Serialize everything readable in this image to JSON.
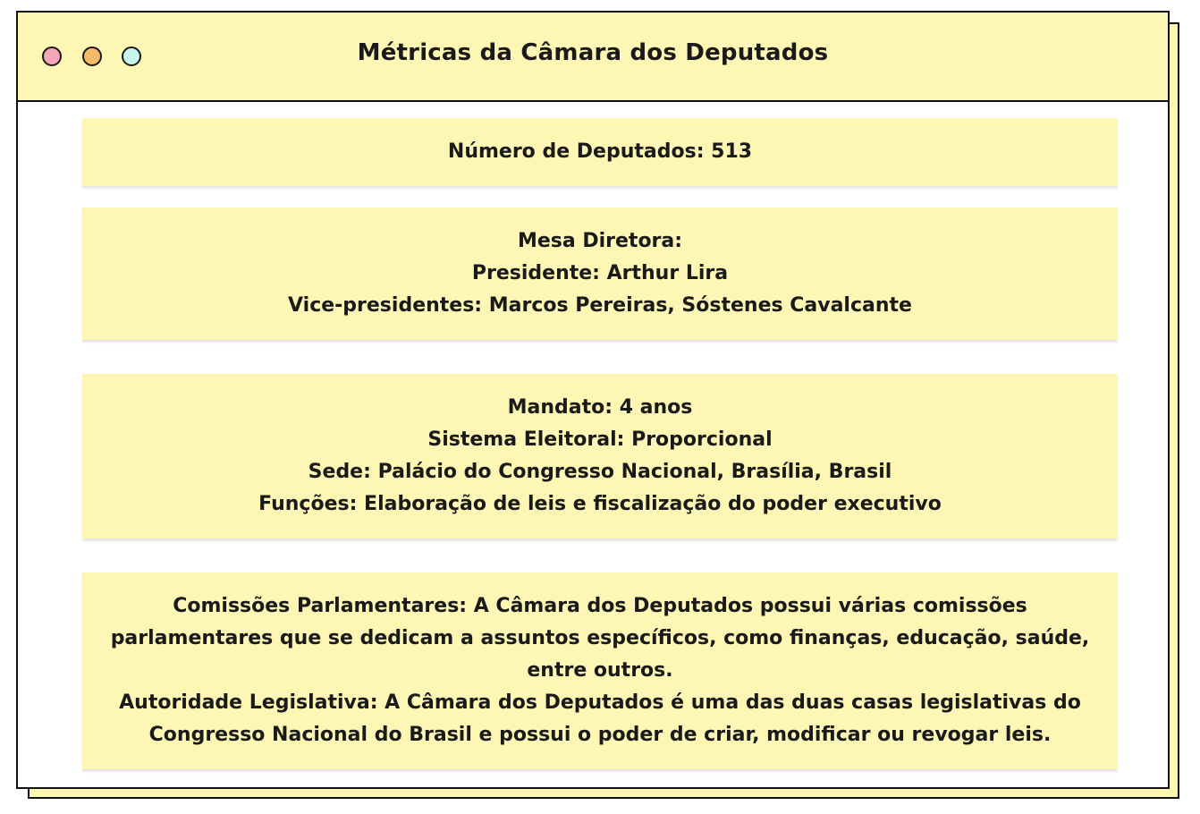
{
  "window": {
    "title": "Métricas da Câmara dos Deputados",
    "controls": {
      "close_color": "#f4a7b9",
      "minimize_color": "#f5b96b",
      "zoom_color": "#c6f4ea"
    }
  },
  "cards": {
    "deputies": {
      "text": "Número de Deputados: 513"
    },
    "board": {
      "heading": "Mesa Diretora:",
      "president": "Presidente: Arthur Lira",
      "vice_presidents": "Vice-presidentes: Marcos Pereiras, Sóstenes Cavalcante"
    },
    "info": {
      "term": "Mandato: 4 anos",
      "electoral_system": "Sistema Eleitoral: Proporcional",
      "seat": "Sede: Palácio do Congresso Nacional, Brasília, Brasil",
      "functions": "Funções: Elaboração de leis e fiscalização do poder executivo"
    },
    "details": {
      "committees": "Comissões Parlamentares: A Câmara dos Deputados possui várias comissões parlamentares que se dedicam a assuntos específicos, como finanças, educação, saúde, entre outros.",
      "authority": "Autoridade Legislativa: A Câmara dos Deputados é uma das duas casas legislativas do Congresso Nacional do Brasil e possui o poder de criar, modificar ou revogar leis."
    }
  },
  "colors": {
    "accent_background": "#fdf6b5",
    "border": "#111111",
    "text": "#1a1a1a"
  }
}
